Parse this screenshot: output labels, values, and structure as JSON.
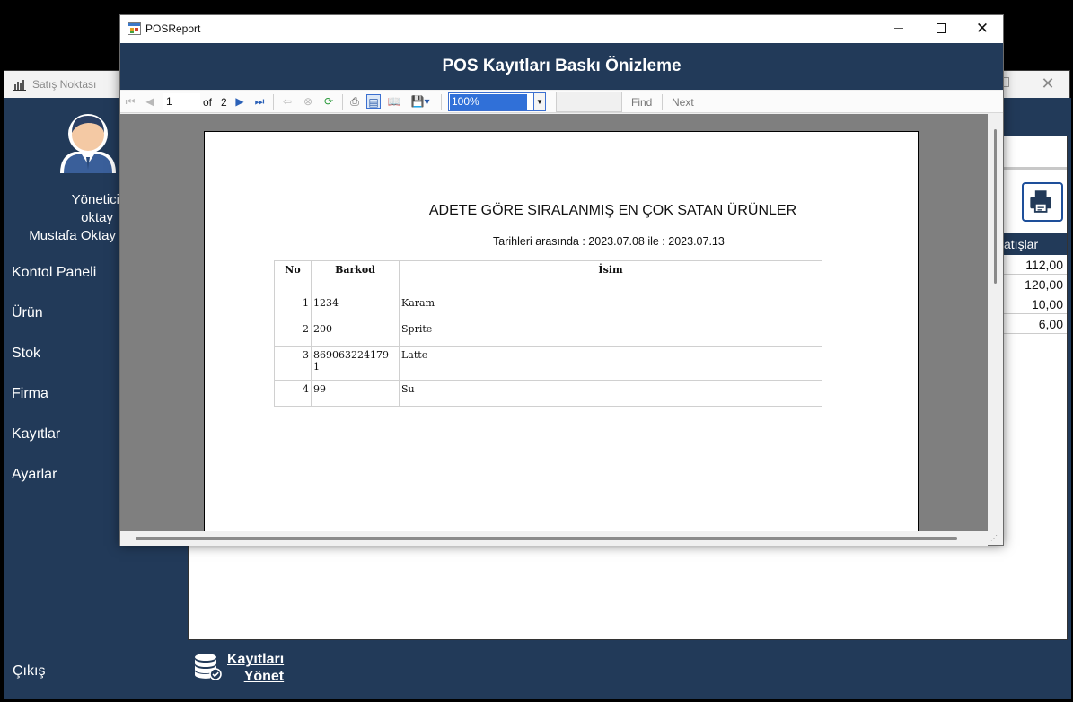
{
  "background_window": {
    "title": "Satış Noktası",
    "user": {
      "role": "Yönetici",
      "username": "oktay",
      "full_name": "Mustafa Oktay"
    },
    "nav": [
      {
        "label": "Kontol Paneli"
      },
      {
        "label": "Ürün"
      },
      {
        "label": "Stok"
      },
      {
        "label": "Firma"
      },
      {
        "label": "Kayıtlar"
      },
      {
        "label": "Ayarlar"
      }
    ],
    "logout_label": "Çıkış",
    "records_link": {
      "line1": "Kayıtları",
      "line2": "Yönet"
    },
    "sales_table": {
      "header": "atışlar",
      "values": [
        "112,00",
        "120,00",
        "10,00",
        "6,00"
      ]
    },
    "colors": {
      "sidebar": "#223a59",
      "accent": "#1e4f9a"
    }
  },
  "report_window": {
    "title": "POSReport",
    "header": "POS Kayıtları Baskı Önizleme",
    "toolbar": {
      "current_page": "1",
      "of_label": "of",
      "total_pages": "2",
      "zoom": "100%",
      "find_label": "Find",
      "next_label": "Next"
    },
    "report": {
      "title": "ADETE GÖRE SIRALANMIŞ EN ÇOK SATAN ÜRÜNLER",
      "date_range": "Tarihleri arasında : 2023.07.08 ile : 2023.07.13",
      "columns": [
        "No",
        "Barkod",
        "İsim"
      ],
      "rows": [
        {
          "no": "1",
          "barcode": "1234",
          "name": "Karam"
        },
        {
          "no": "2",
          "barcode": "200",
          "name": "Sprite"
        },
        {
          "no": "3",
          "barcode": "869063224179",
          "barcode_wrap": "1",
          "name": "Latte"
        },
        {
          "no": "4",
          "barcode": "99",
          "name": "Su"
        }
      ]
    }
  }
}
